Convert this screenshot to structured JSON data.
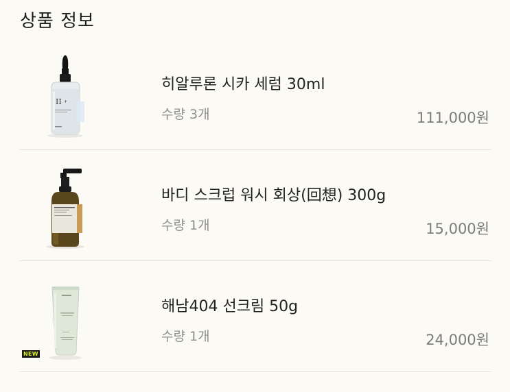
{
  "section": {
    "title": "상품 정보"
  },
  "items": [
    {
      "name": "히알루론 시카 세럼 30ml",
      "quantity": "수량 3개",
      "price": "111,000원",
      "image_icon": "serum-dropper-bottle-icon",
      "badge": ""
    },
    {
      "name": "바디 스크럽 워시 회상(回想) 300g",
      "quantity": "수량 1개",
      "price": "15,000원",
      "image_icon": "amber-pump-bottle-icon",
      "badge": ""
    },
    {
      "name": "해남404 선크림 50g",
      "quantity": "수량 1개",
      "price": "24,000원",
      "image_icon": "sunscreen-tube-icon",
      "badge": "NEW"
    }
  ],
  "colors": {
    "background": "#fbfaf4",
    "divider": "#e4e2da",
    "new_badge_bg": "#1a1a1a",
    "new_badge_text": "#d8f12a"
  }
}
